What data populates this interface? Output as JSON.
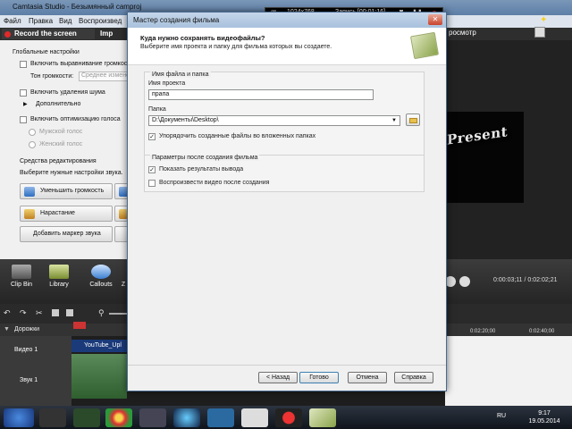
{
  "app": {
    "title": "Camtasia Studio - Безымянный camproj",
    "menu": [
      "Файл",
      "Правка",
      "Вид",
      "Воспроизвед"
    ],
    "record_label": "Record the screen",
    "import_label": "Imp",
    "preview_label": "росмотр"
  },
  "recording": {
    "resolution": "1024x768",
    "status": "Запись [00:01:16]"
  },
  "left_panel": {
    "section_global": "Глобальные настройки",
    "cb_volume": "Включить выравнивание громкост",
    "tone_label": "Тон громкости:",
    "tone_value": "Среднее измене",
    "cb_noise": "Включить удаления шума",
    "advanced": "Дополнительно",
    "cb_voice": "Включить оптимизацию голоса",
    "male_voice": "Мужской голос",
    "female_voice": "Женский голос",
    "edit_tools": "Средства редактирования",
    "edit_hint": "Выберите нужные настройки звука.",
    "btn_reduce": "Уменьшить громкость",
    "btn_fadein": "Нарастание",
    "btn_marker": "Добавить маркер звука"
  },
  "preview": {
    "watermark": "Present",
    "timecode": "0:00:03;11 / 0:02:02;21"
  },
  "clip_bin": {
    "items": [
      "Clip Bin",
      "Library",
      "Callouts",
      "Z"
    ]
  },
  "timeline": {
    "tracks_label": "Дорожки",
    "video_track": "Видео 1",
    "audio_track": "Звук 1",
    "clip_name": "YouTube_Upl",
    "ruler_ticks": [
      "0:02:20;00",
      "0:02:40;00"
    ]
  },
  "dialog": {
    "title": "Мастер создания фильма",
    "heading": "Куда нужно сохранять видеофайлы?",
    "subheading": "Выберите имя проекта и папку для фильма которых вы создаете.",
    "group_file": "Имя файла и папка",
    "project_label": "Имя проекта",
    "project_value": "прапа",
    "folder_label": "Папка",
    "folder_value": "D:\\Документы\\Desktop\\",
    "cb_organize": "Упорядочить созданные файлы во вложенных папках",
    "group_after": "Параметры после создания фильма",
    "cb_show": "Показать результаты вывода",
    "cb_play": "Воспроизвести видео после создания",
    "btn_back": "< Назад",
    "btn_finish": "Готово",
    "btn_cancel": "Отмена",
    "btn_help": "Справка"
  },
  "taskbar": {
    "lang": "RU",
    "time": "9:17",
    "date": "19.05.2014"
  }
}
